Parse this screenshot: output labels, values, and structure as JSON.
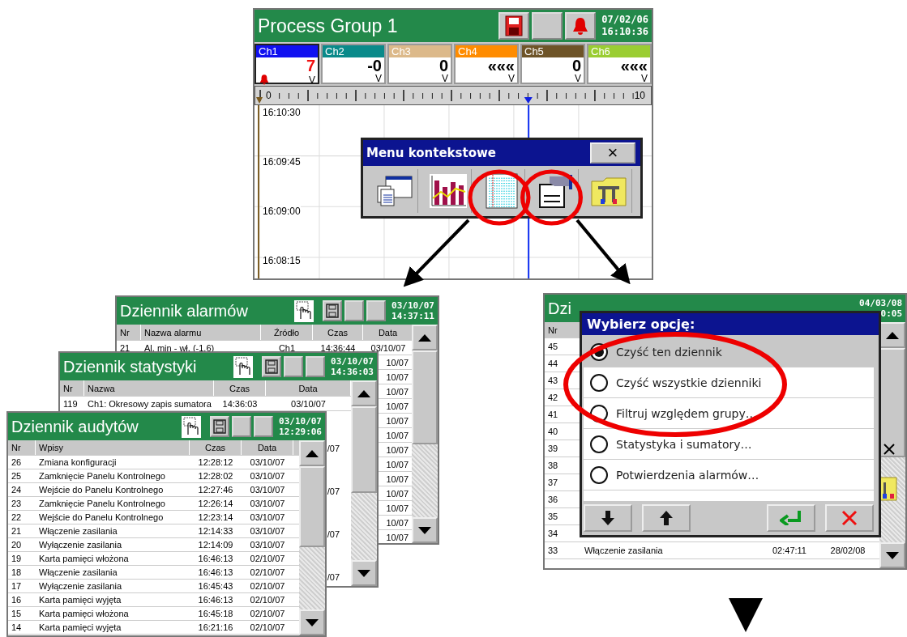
{
  "process_screen": {
    "title": "Process Group 1",
    "date": "07/02/06",
    "time": "16:10:36",
    "channels": [
      {
        "name": "Ch1",
        "value": "7",
        "unit": "V",
        "color": "#1010f0",
        "alarm": true
      },
      {
        "name": "Ch2",
        "value": "-0",
        "unit": "V",
        "color": "#0a8a8a",
        "alarm": false
      },
      {
        "name": "Ch3",
        "value": "0",
        "unit": "V",
        "color": "#dcb98a",
        "alarm": false
      },
      {
        "name": "Ch4",
        "value": "«««",
        "unit": "V",
        "color": "#ff8c00",
        "alarm": false
      },
      {
        "name": "Ch5",
        "value": "0",
        "unit": "V",
        "color": "#6e5428",
        "alarm": false
      },
      {
        "name": "Ch6",
        "value": "«««",
        "unit": "V",
        "color": "#9acd32",
        "alarm": false
      }
    ],
    "scale": {
      "min": "0",
      "max": "10"
    },
    "time_labels": [
      "16:10:30",
      "16:09:45",
      "16:09:00",
      "16:08:15"
    ],
    "context_menu": {
      "title": "Menu kontekstowe",
      "close": "×",
      "items": [
        {
          "kind": "windows",
          "circled": false
        },
        {
          "kind": "chart",
          "circled": false
        },
        {
          "kind": "log",
          "circled": true
        },
        {
          "kind": "audit",
          "circled": true
        },
        {
          "kind": "tools",
          "circled": false
        }
      ]
    }
  },
  "logs": [
    {
      "kind": "alarm",
      "title": "Dziennik alarmów",
      "date": "03/10/07",
      "time": "14:37:11",
      "columns": [
        "Nr",
        "Nazwa alarmu",
        "Źródło",
        "Czas",
        "Data"
      ],
      "rows": [
        [
          "21",
          "Al. min - wł. (-1.6)",
          "Ch1",
          "14:36:44",
          "03/10/07"
        ]
      ],
      "fragments": [
        "10/07",
        "10/07",
        "10/07",
        "10/07",
        "10/07",
        "10/07",
        "10/07",
        "10/07",
        "10/07",
        "10/07",
        "10/07",
        "10/07",
        "10/07"
      ]
    },
    {
      "kind": "statistics",
      "title": "Dziennik statystyki",
      "date": "03/10/07",
      "time": "14:36:03",
      "columns": [
        "Nr",
        "Nazwa",
        "Czas",
        "Data"
      ],
      "rows": [
        [
          "119",
          "Ch1: Okresowy zapis sumatora",
          "14:36:03",
          "03/10/07"
        ]
      ],
      "fragments": [
        "/07",
        "/07",
        "/07",
        "/07"
      ]
    },
    {
      "kind": "audit",
      "title": "Dziennik audytów",
      "date": "03/10/07",
      "time": "12:29:06",
      "columns": [
        "Nr",
        "Wpisy",
        "Czas",
        "Data"
      ],
      "rows": [
        [
          "26",
          "Zmiana konfiguracji",
          "12:28:12",
          "03/10/07"
        ],
        [
          "25",
          "Zamknięcie Panelu Kontrolnego",
          "12:28:02",
          "03/10/07"
        ],
        [
          "24",
          "Wejście do Panelu Kontrolnego",
          "12:27:46",
          "03/10/07"
        ],
        [
          "23",
          "Zamknięcie Panelu Kontrolnego",
          "12:26:14",
          "03/10/07"
        ],
        [
          "22",
          "Wejście do Panelu Kontrolnego",
          "12:23:14",
          "03/10/07"
        ],
        [
          "21",
          "Włączenie zasilania",
          "12:14:33",
          "03/10/07"
        ],
        [
          "20",
          "Wyłączenie zasilania",
          "12:14:09",
          "03/10/07"
        ],
        [
          "19",
          "Karta pamięci włożona",
          "16:46:13",
          "02/10/07"
        ],
        [
          "18",
          "Włączenie zasilania",
          "16:46:13",
          "02/10/07"
        ],
        [
          "17",
          "Wyłączenie zasilania",
          "16:45:43",
          "02/10/07"
        ],
        [
          "16",
          "Karta pamięci wyjęta",
          "16:46:13",
          "02/10/07"
        ],
        [
          "15",
          "Karta pamięci włożona",
          "16:45:18",
          "02/10/07"
        ],
        [
          "14",
          "Karta pamięci wyjęta",
          "16:21:16",
          "02/10/07"
        ]
      ]
    }
  ],
  "options_screen": {
    "title": "Dzi",
    "date": "04/03/08",
    "time": "0:05",
    "column": "Nr",
    "rows": [
      {
        "nr": "45"
      },
      {
        "nr": "44"
      },
      {
        "nr": "43"
      },
      {
        "nr": "42"
      },
      {
        "nr": "41"
      },
      {
        "nr": "40"
      },
      {
        "nr": "39"
      },
      {
        "nr": "38"
      },
      {
        "nr": "37"
      },
      {
        "nr": "36"
      },
      {
        "nr": "35"
      },
      {
        "nr": "34"
      },
      {
        "nr": "33",
        "entry": "Włączenie zasilania",
        "time": "02:47:11",
        "date": "28/02/08"
      }
    ],
    "dialog": {
      "title": "Wybierz opcję:",
      "options": [
        {
          "label": "Czyść ten dziennik",
          "selected": true
        },
        {
          "label": "Czyść wszystkie dzienniki",
          "selected": false
        },
        {
          "label": "Filtruj względem grupy…",
          "selected": false
        },
        {
          "label": "Statystyka i sumatory…",
          "selected": false
        },
        {
          "label": "Potwierdzenia alarmów…",
          "selected": false
        }
      ],
      "buttons": [
        {
          "kind": "down"
        },
        {
          "kind": "up"
        },
        {
          "kind": "enter"
        },
        {
          "kind": "cancel"
        }
      ]
    }
  }
}
